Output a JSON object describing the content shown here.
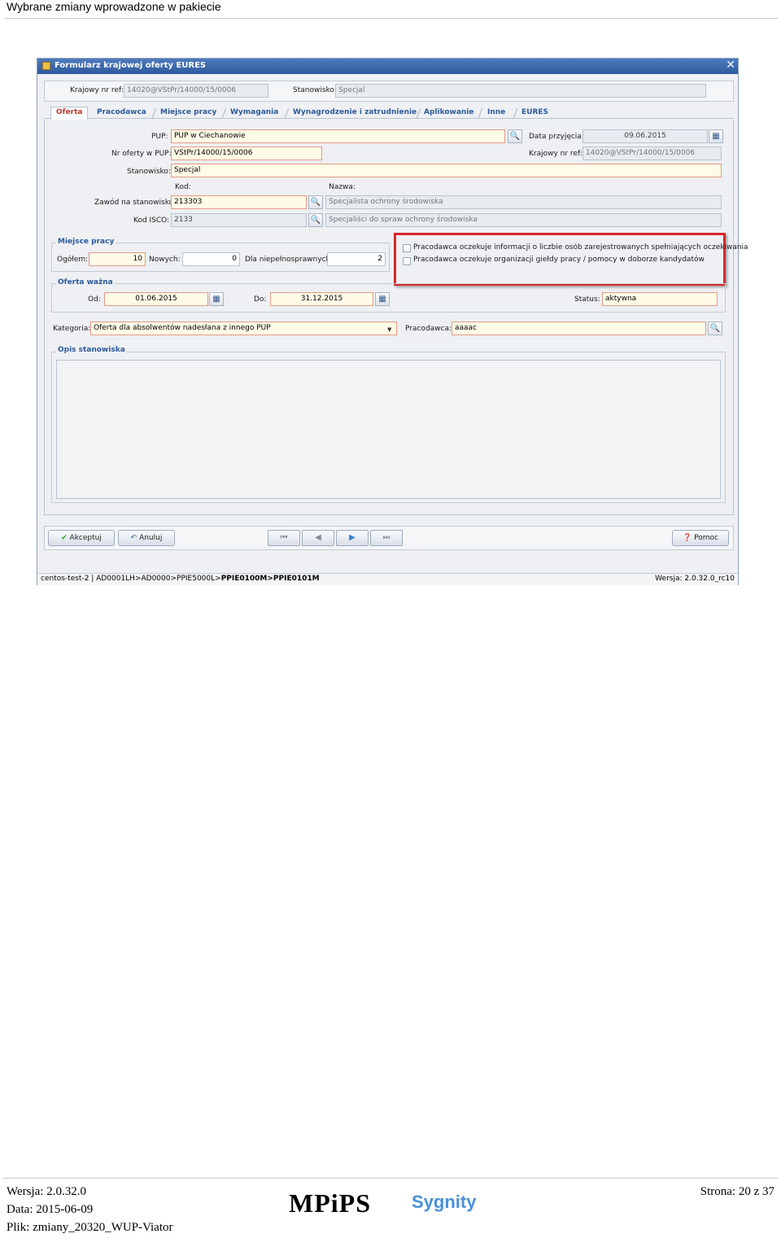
{
  "doc": {
    "header_title": "Wybrane zmiany wprowadzone w pakiecie",
    "footer": {
      "version": "Wersja: 2.0.32.0",
      "date": "Data: 2015-06-09",
      "file": "Plik: zmiany_20320_WUP-Viator",
      "logo_text": "MPiPS",
      "brand": "Sygnity",
      "page": "Strona: 20 z 37"
    }
  },
  "window": {
    "title": "Formularz krajowej oferty EURES",
    "close_glyph": "✕",
    "top": {
      "ref_label": "Krajowy nr ref:",
      "ref_value": "14020@VStPr/14000/15/0006",
      "stanowisko_label": "Stanowisko:",
      "stanowisko_value": "Specjal"
    },
    "tabs": [
      "Oferta",
      "Pracodawca",
      "Miejsce pracy",
      "Wymagania",
      "Wynagrodzenie i zatrudnienie",
      "Aplikowanie",
      "Inne",
      "EURES"
    ],
    "form": {
      "pup_label": "PUP:",
      "pup_value": "PUP w Ciechanowie",
      "data_label": "Data przyjęcia:",
      "data_value": "09.06.2015",
      "nr_label": "Nr oferty w PUP:",
      "nr_value": "VStPr/14000/15/0006",
      "kref_label": "Krajowy nr ref:",
      "kref_value": "14020@VStPr/14000/15/0006",
      "stan_label": "Stanowisko:",
      "stan_value": "Specjal",
      "kod_head": "Kod:",
      "nazwa_head": "Nazwa:",
      "zawod_label": "Zawód na stanowisku:",
      "zawod_kod": "213303",
      "zawod_nazwa": "Specjalista ochrony środowiska",
      "isco_label": "Kod ISCO:",
      "isco_kod": "2133",
      "isco_nazwa": "Specjaliści do spraw ochrony środowiska"
    },
    "miejsca": {
      "title": "Miejsce pracy",
      "ogolem_label": "Ogółem:",
      "ogolem": "10",
      "nowych_label": "Nowych:",
      "nowych": "0",
      "niepeln_label": "Dla niepełnosprawnych:",
      "niepeln": "2"
    },
    "checks": {
      "c1": "Pracodawca oczekuje informacji o liczbie osób zarejestrowanych spełniających oczekiwania",
      "c2": "Pracodawca oczekuje organizacji giełdy pracy / pomocy w doborze kandydatów",
      "highlight_color": "#d9262b"
    },
    "wazna": {
      "title": "Oferta ważna",
      "od_label": "Od:",
      "od": "01.06.2015",
      "do_label": "Do:",
      "do": "31.12.2015",
      "status_label": "Status:",
      "status": "aktywna"
    },
    "kategoria_label": "Kategoria:",
    "kategoria": "Oferta dla absolwentów nadesłana z innego PUP",
    "pracodawca_label": "Pracodawca:",
    "pracodawca": "aaaac",
    "opis_title": "Opis stanowiska",
    "buttons": {
      "akceptuj": "Akceptuj",
      "anuluj": "Anuluj",
      "pomoc": "Pomoc"
    },
    "nav": [
      "⏮",
      "◀",
      "▶",
      "⏭"
    ],
    "status": {
      "path": "centos-test-2 | AD0001LH>AD0000>PPIE5000L>",
      "path_bold": "PPIE0100M>PPIE0101M",
      "version": "Wersja: 2.0.32.0_rc10"
    }
  }
}
